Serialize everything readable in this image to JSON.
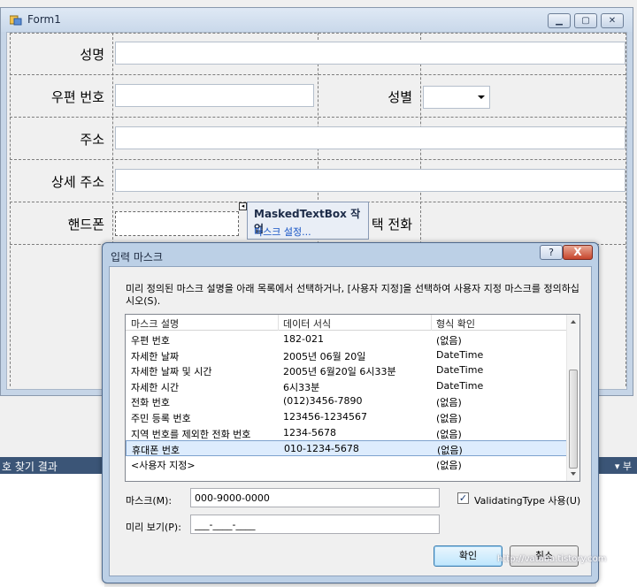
{
  "form1": {
    "title": "Form1",
    "fields": {
      "name_label": "성명",
      "postal_label": "우편 번호",
      "gender_label": "성별",
      "address_label": "주소",
      "detail_address_label": "상세 주소",
      "mobile_label": "핸드폰",
      "phone_label": "택 전화"
    },
    "smart_tag": {
      "title": "MaskedTextBox 작업",
      "link": "마스크 설정..."
    }
  },
  "dock": {
    "left_text": "호 찾기 결과",
    "right_text": "▾ 부"
  },
  "dialog": {
    "title": "입력 마스크",
    "help_label": "?",
    "close_label": "X",
    "description": "미리 정의된 마스크 설명을 아래 목록에서 선택하거나, [사용자 지정]을 선택하여 사용자 지정 마스크를 정의하십시오(S).",
    "columns": [
      "마스크 설명",
      "데이터 서식",
      "형식 확인"
    ],
    "rows": [
      {
        "desc": "우편 번호",
        "format": "182-021",
        "type": "(없음)"
      },
      {
        "desc": "자세한 날짜",
        "format": "2005년 06월 20일",
        "type": "DateTime"
      },
      {
        "desc": "자세한 날짜 및 시간",
        "format": "2005년 6월20일  6시33분",
        "type": "DateTime"
      },
      {
        "desc": "자세한 시간",
        "format": " 6시33분",
        "type": "DateTime"
      },
      {
        "desc": "전화 번호",
        "format": "(012)3456-7890",
        "type": "(없음)"
      },
      {
        "desc": "주민 등록 번호",
        "format": "123456-1234567",
        "type": "(없음)"
      },
      {
        "desc": "지역 번호를 제외한 전화 번호",
        "format": "1234-5678",
        "type": "(없음)"
      },
      {
        "desc": "휴대폰 번호",
        "format": "010-1234-5678",
        "type": "(없음)"
      },
      {
        "desc": "<사용자 지정>",
        "format": "",
        "type": "(없음)"
      }
    ],
    "selected_index": 7,
    "mask_label": "마스크(M):",
    "mask_value": "000-9000-0000",
    "validating_label": "ValidatingType 사용(U)",
    "validating_checked": "✓",
    "preview_label": "미리 보기(P):",
    "preview_value": "___-____-____",
    "ok_label": "확인",
    "cancel_label": "취소"
  },
  "watermark": "http://vataba.tistory.com"
}
